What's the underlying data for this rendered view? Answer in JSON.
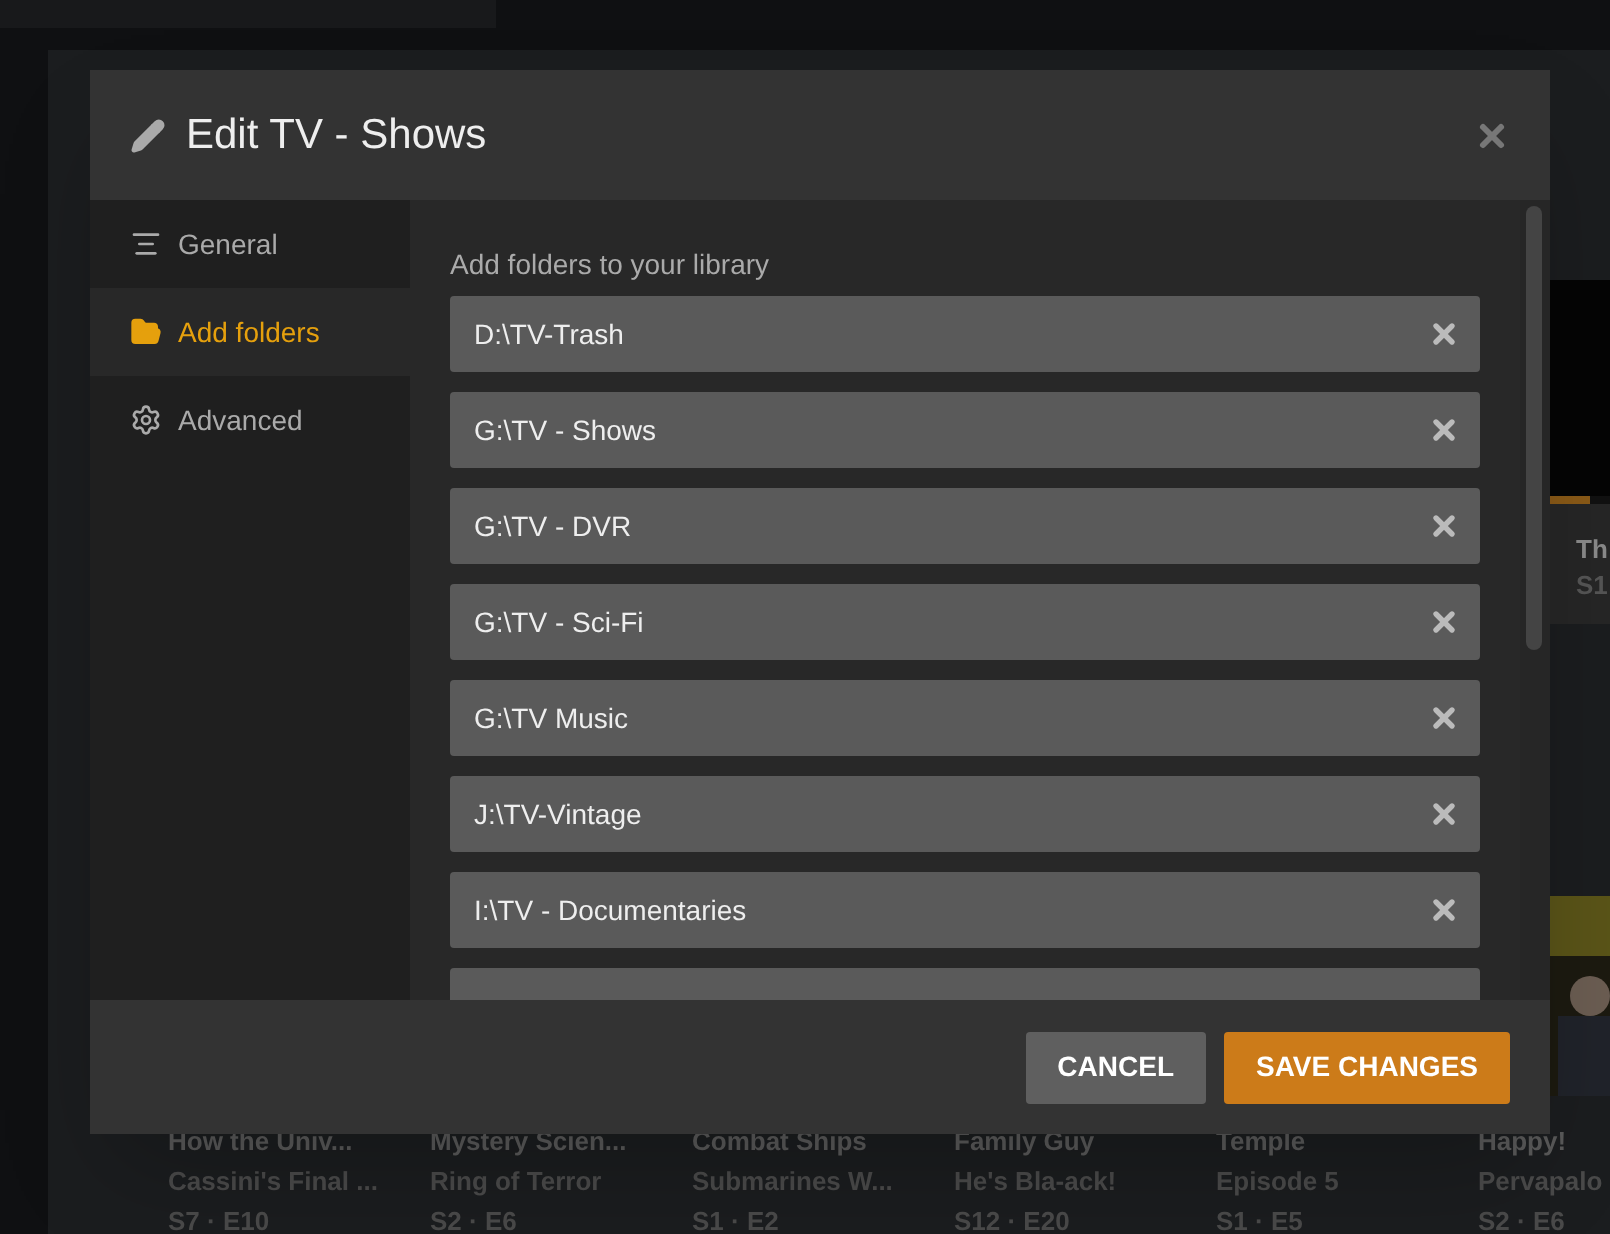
{
  "dialog": {
    "title": "Edit TV - Shows",
    "nav": [
      {
        "label": "General",
        "kind": "general",
        "selected": false
      },
      {
        "label": "Add folders",
        "kind": "folders",
        "selected": true
      },
      {
        "label": "Advanced",
        "kind": "advanced",
        "selected": false
      }
    ],
    "section_label": "Add folders to your library",
    "folders": [
      {
        "path": "D:\\TV-Trash"
      },
      {
        "path": "G:\\TV - Shows"
      },
      {
        "path": "G:\\TV - DVR"
      },
      {
        "path": "G:\\TV - Sci-Fi"
      },
      {
        "path": "G:\\TV Music"
      },
      {
        "path": "J:\\TV-Vintage"
      },
      {
        "path": "I:\\TV - Documentaries"
      }
    ],
    "more_rows_below": true,
    "buttons": [
      {
        "label": "CANCEL",
        "kind": "secondary"
      },
      {
        "label": "SAVE CHANGES",
        "kind": "primary"
      }
    ]
  },
  "background": {
    "side_tile": {
      "title": "Th",
      "subtitle": "S1",
      "level": 0.67
    },
    "tiles": [
      {
        "title": "How the Univ...",
        "subtitle": "Cassini's Final ...",
        "episode": "S7 · E10"
      },
      {
        "title": "Mystery Scien...",
        "subtitle": "Ring of Terror",
        "episode": "S2 · E6"
      },
      {
        "title": "Combat Ships",
        "subtitle": "Submarines W...",
        "episode": "S1 · E2"
      },
      {
        "title": "Family Guy",
        "subtitle": "He's Bla-ack!",
        "episode": "S12 · E20"
      },
      {
        "title": "Temple",
        "subtitle": "Episode 5",
        "episode": "S1 · E5"
      },
      {
        "title": "Happy!",
        "subtitle": "Pervapalo",
        "episode": "S2 · E6"
      }
    ]
  }
}
